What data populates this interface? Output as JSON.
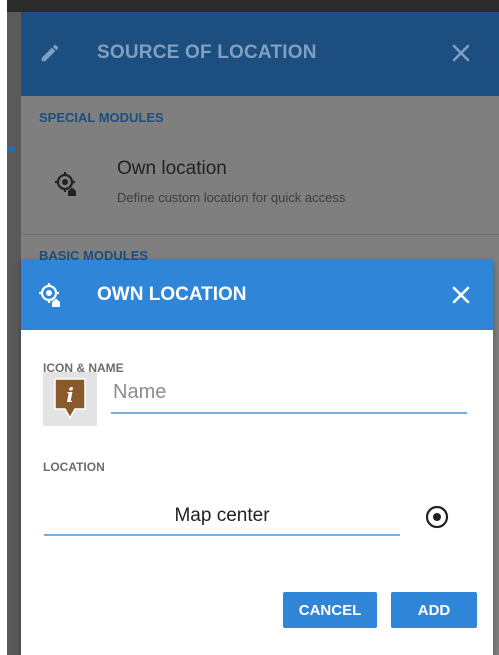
{
  "background_dialog": {
    "title": "SOURCE OF LOCATION",
    "section_special": "SPECIAL MODULES",
    "item": {
      "title": "Own location",
      "subtitle": "Define custom location for quick access"
    },
    "section_basic": "BASIC MODULES",
    "icons": {
      "edit": "pencil-icon",
      "close": "close-icon",
      "item": "location-home-icon"
    }
  },
  "dialog": {
    "title": "OWN LOCATION",
    "icon_name_label": "ICON & NAME",
    "name_placeholder": "Name",
    "name_value": "",
    "location_label": "LOCATION",
    "location_value": "Map center",
    "cancel_label": "CANCEL",
    "add_label": "ADD",
    "icons": {
      "header": "location-home-icon",
      "close": "close-icon",
      "poi": "info-poi-icon",
      "target": "target-icon"
    }
  },
  "colors": {
    "accent": "#2f86d8",
    "header_dimmed": "#1c4f7f",
    "overlay": "#7f7f7f",
    "input_underline": "#6fb0e6",
    "poi_brown": "#8a5a2b"
  }
}
